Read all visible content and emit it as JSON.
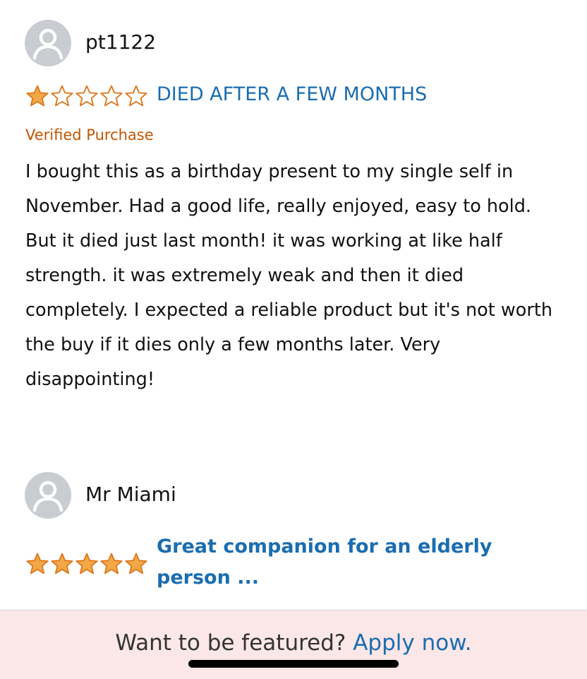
{
  "reviews": [
    {
      "username": "pt1122",
      "rating": 1,
      "max_rating": 5,
      "title": "DIED AFTER A FEW MONTHS",
      "verified_label": "Verified Purchase",
      "body": "I bought this as a birthday present to my single self in November. Had a good life, really enjoyed, easy to hold. But it died just last month! it was working at like half strength. it was extremely weak and then it died completely. I expected a reliable product but it's not worth the buy if it dies only a few months later. Very disappointing!"
    },
    {
      "username": "Mr Miami",
      "rating": 5,
      "max_rating": 5,
      "title": "Great companion for an elderly person ..."
    }
  ],
  "banner": {
    "prompt": "Want to be featured?",
    "link": "Apply now."
  },
  "colors": {
    "star": "#f3a847",
    "star_outline": "#de7921",
    "link": "#1a6db0",
    "verified": "#c45500",
    "avatar_bg": "#c9ccd0",
    "banner_bg": "#fbe7e7"
  }
}
